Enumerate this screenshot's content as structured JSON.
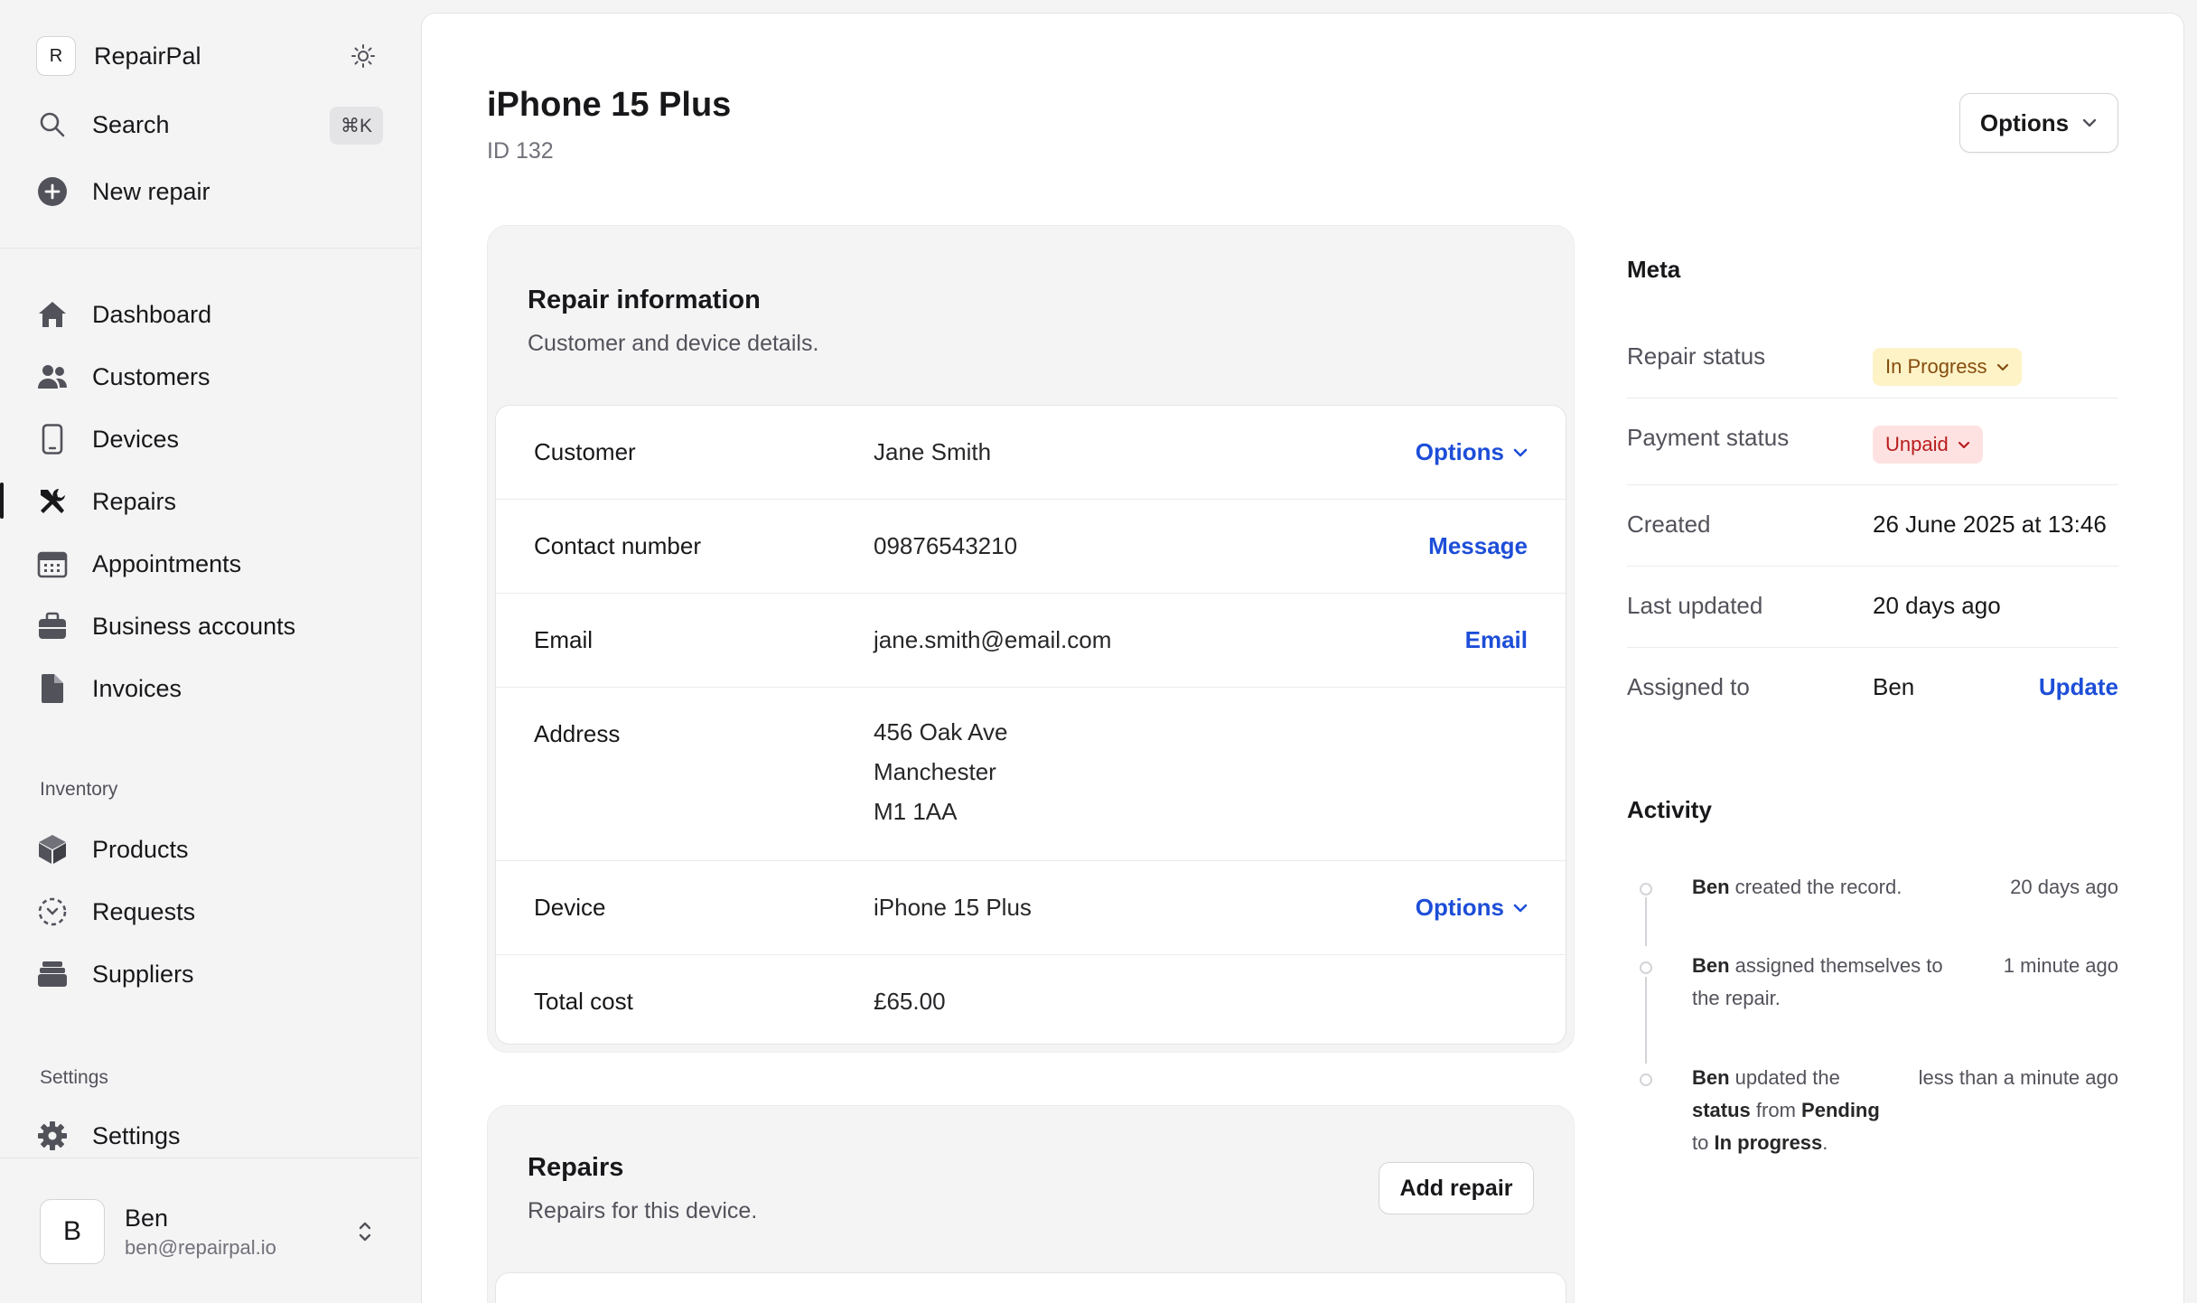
{
  "app": {
    "logo_letter": "R",
    "name": "RepairPal"
  },
  "sidebar": {
    "search_label": "Search",
    "search_shortcut": "⌘K",
    "new_repair_label": "New repair",
    "nav": [
      {
        "label": "Dashboard",
        "icon": "home-icon"
      },
      {
        "label": "Customers",
        "icon": "users-icon"
      },
      {
        "label": "Devices",
        "icon": "phone-icon"
      },
      {
        "label": "Repairs",
        "icon": "wrench-icon",
        "active": true
      },
      {
        "label": "Appointments",
        "icon": "calendar-icon"
      },
      {
        "label": "Business accounts",
        "icon": "briefcase-icon"
      },
      {
        "label": "Invoices",
        "icon": "document-icon"
      }
    ],
    "inventory_heading": "Inventory",
    "inventory": [
      {
        "label": "Products",
        "icon": "cube-icon"
      },
      {
        "label": "Requests",
        "icon": "dashed-request-icon"
      },
      {
        "label": "Suppliers",
        "icon": "stack-icon"
      }
    ],
    "settings_heading": "Settings",
    "settings_label": "Settings",
    "user": {
      "initial": "B",
      "name": "Ben",
      "email": "ben@repairpal.io"
    }
  },
  "page": {
    "title": "iPhone 15 Plus",
    "id_text": "ID 132",
    "options_label": "Options"
  },
  "repair_info": {
    "title": "Repair information",
    "subtitle": "Customer and device details.",
    "rows": {
      "customer": {
        "label": "Customer",
        "value": "Jane Smith",
        "action": "Options"
      },
      "contact": {
        "label": "Contact number",
        "value": "09876543210",
        "action": "Message"
      },
      "email": {
        "label": "Email",
        "value": "jane.smith@email.com",
        "action": "Email"
      },
      "address": {
        "label": "Address",
        "lines": [
          "456 Oak Ave",
          "Manchester",
          "M1 1AA"
        ]
      },
      "device": {
        "label": "Device",
        "value": "iPhone 15 Plus",
        "action": "Options"
      },
      "total": {
        "label": "Total cost",
        "value": "£65.00"
      }
    }
  },
  "repairs_card": {
    "title": "Repairs",
    "subtitle": "Repairs for this device.",
    "add_label": "Add repair"
  },
  "meta": {
    "heading": "Meta",
    "repair_status": {
      "label": "Repair status",
      "value": "In Progress"
    },
    "payment_status": {
      "label": "Payment status",
      "value": "Unpaid"
    },
    "created": {
      "label": "Created",
      "value": "26 June 2025 at 13:46"
    },
    "last_updated": {
      "label": "Last updated",
      "value": "20 days ago"
    },
    "assigned": {
      "label": "Assigned to",
      "value": "Ben",
      "action": "Update"
    }
  },
  "activity": {
    "heading": "Activity",
    "items": [
      {
        "actor": "Ben",
        "text": " created the record.",
        "time": "20 days ago"
      },
      {
        "actor": "Ben",
        "text": " assigned themselves to the repair.",
        "time": "1 minute ago"
      },
      {
        "actor": "Ben",
        "text_1": " updated the ",
        "bold_1": "status",
        "text_2": " from ",
        "bold_2": "Pending",
        "text_3": " to ",
        "bold_3": "In progress",
        "text_4": ".",
        "time": "less than a minute ago"
      }
    ]
  },
  "colors": {
    "link": "#1d4ed8",
    "in_progress_bg": "#fef3c7",
    "in_progress_text": "#854d0e",
    "unpaid_bg": "#fee2e2",
    "unpaid_text": "#b91c1c"
  }
}
